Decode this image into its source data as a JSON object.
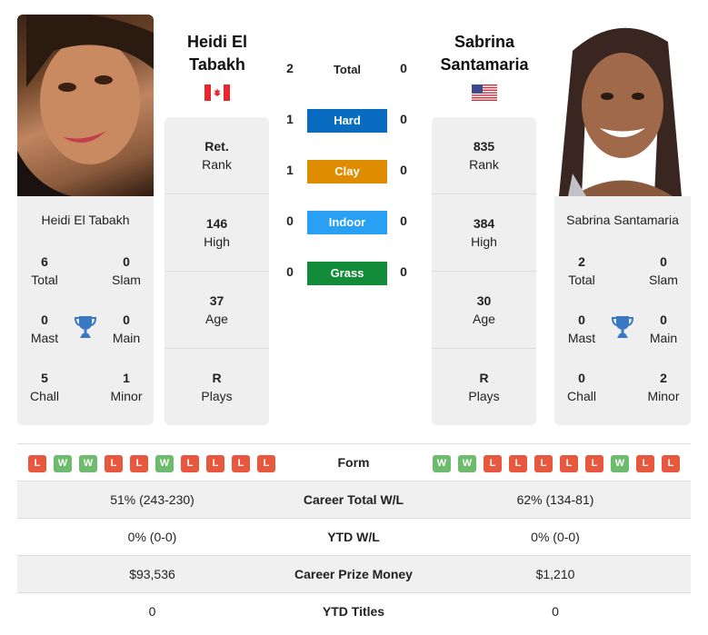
{
  "players": {
    "left": {
      "name_header": "Heidi El Tabakh",
      "card_name": "Heidi El Tabakh",
      "country_flag": "canada-flag",
      "photo": "player-photo",
      "titles": {
        "total": {
          "value": "6",
          "label": "Total"
        },
        "slam": {
          "value": "0",
          "label": "Slam"
        },
        "mast": {
          "value": "0",
          "label": "Mast"
        },
        "main": {
          "value": "0",
          "label": "Main"
        },
        "chall": {
          "value": "5",
          "label": "Chall"
        },
        "minor": {
          "value": "1",
          "label": "Minor"
        }
      },
      "stats": [
        {
          "value": "Ret.",
          "label": "Rank"
        },
        {
          "value": "146",
          "label": "High"
        },
        {
          "value": "37",
          "label": "Age"
        },
        {
          "value": "R",
          "label": "Plays"
        }
      ],
      "form": [
        "L",
        "W",
        "W",
        "L",
        "L",
        "W",
        "L",
        "L",
        "L",
        "L"
      ]
    },
    "right": {
      "name_header": "Sabrina Santamaria",
      "card_name": "Sabrina Santamaria",
      "country_flag": "usa-flag",
      "photo": "player-photo",
      "titles": {
        "total": {
          "value": "2",
          "label": "Total"
        },
        "slam": {
          "value": "0",
          "label": "Slam"
        },
        "mast": {
          "value": "0",
          "label": "Mast"
        },
        "main": {
          "value": "0",
          "label": "Main"
        },
        "chall": {
          "value": "0",
          "label": "Chall"
        },
        "minor": {
          "value": "2",
          "label": "Minor"
        }
      },
      "stats": [
        {
          "value": "835",
          "label": "Rank"
        },
        {
          "value": "384",
          "label": "High"
        },
        {
          "value": "30",
          "label": "Age"
        },
        {
          "value": "R",
          "label": "Plays"
        }
      ],
      "form": [
        "W",
        "W",
        "L",
        "L",
        "L",
        "L",
        "L",
        "W",
        "L",
        "L"
      ]
    }
  },
  "h2h": {
    "total": {
      "label": "Total",
      "left": "2",
      "right": "0"
    },
    "surfaces": [
      {
        "label": "Hard",
        "left": "1",
        "right": "0",
        "color": "#0a6cc0"
      },
      {
        "label": "Clay",
        "left": "1",
        "right": "0",
        "color": "#e08c00"
      },
      {
        "label": "Indoor",
        "left": "0",
        "right": "0",
        "color": "#2aa0f5"
      },
      {
        "label": "Grass",
        "left": "0",
        "right": "0",
        "color": "#138c3a"
      }
    ]
  },
  "comparison": {
    "form_label": "Form",
    "rows": [
      {
        "label": "Career Total W/L",
        "left": "51% (243-230)",
        "right": "62% (134-81)"
      },
      {
        "label": "YTD W/L",
        "left": "0% (0-0)",
        "right": "0% (0-0)"
      },
      {
        "label": "Career Prize Money",
        "left": "$93,536",
        "right": "$1,210"
      },
      {
        "label": "YTD Titles",
        "left": "0",
        "right": "0"
      }
    ]
  },
  "colors": {
    "win": "#6dbb6d",
    "loss": "#e8583f",
    "trophy": "#3a78c3",
    "card_bg": "#efefef"
  }
}
